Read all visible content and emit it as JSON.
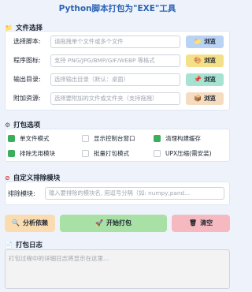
{
  "title": "Python脚本打包为\"EXE\"工具",
  "file_section": {
    "heading": "文件选择",
    "rows": [
      {
        "label": "选择脚本:",
        "placeholder": "请拖拽单个文件或多个文件",
        "button": "浏览",
        "icon": "folder-icon",
        "color": "#b9d3f5"
      },
      {
        "label": "程序图标:",
        "placeholder": "支持 PNG/JPG/BMP/GIF/WEBP 等格式",
        "button": "浏览",
        "icon": "palette-icon",
        "color": "#f5e08a"
      },
      {
        "label": "输出目录:",
        "placeholder": "选择输出目录（默认：桌面）",
        "button": "浏览",
        "icon": "pin-icon",
        "color": "#a7e3d2"
      },
      {
        "label": "附加资源:",
        "placeholder": "选择要附加的文件或文件夹（支持拖拽）",
        "button": "浏览",
        "icon": "box-icon",
        "color": "#f5dcc0"
      }
    ]
  },
  "options_section": {
    "heading": "打包选项",
    "options": [
      {
        "label": "单文件模式",
        "checked": true
      },
      {
        "label": "显示控制台窗口",
        "checked": false
      },
      {
        "label": "清理构建缓存",
        "checked": true
      },
      {
        "label": "排除无用模块",
        "checked": true
      },
      {
        "label": "批量打包模式",
        "checked": false
      },
      {
        "label": "UPX压缩(需安装)",
        "checked": false
      }
    ]
  },
  "exclude_section": {
    "heading": "自定义排除模块",
    "label": "排除模块:",
    "placeholder": "输入要排除的模块名, 用逗号分隔（如: numpy,pand..."
  },
  "actions": {
    "analyze": "分析依赖",
    "build": "开始打包",
    "clear": "清空",
    "colors": {
      "analyze": "#fbdcb0",
      "build": "#a9e0a5",
      "clear": "#f6b9c0"
    }
  },
  "log_section": {
    "heading": "打包日志",
    "placeholder": "打包过程中的详细日志将显示在这里..."
  }
}
